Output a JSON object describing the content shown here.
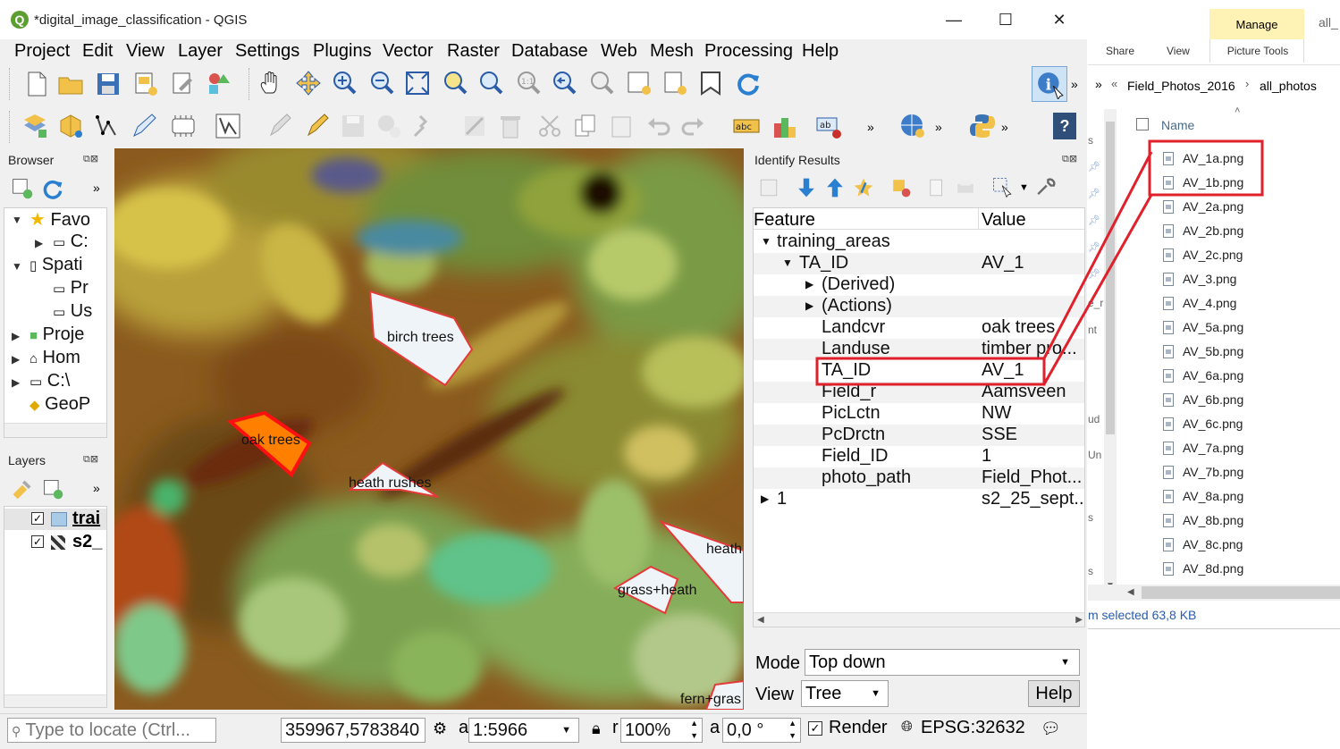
{
  "window": {
    "title": "*digital_image_classification - QGIS"
  },
  "menu": [
    "Project",
    "Edit",
    "View",
    "Layer",
    "Settings",
    "Plugins",
    "Vector",
    "Raster",
    "Database",
    "Web",
    "Mesh",
    "Processing",
    "Help"
  ],
  "browser": {
    "title": "Browser",
    "items": [
      {
        "label": "Favo",
        "icon": "star-icon"
      },
      {
        "label": "C:",
        "icon": "folder-icon"
      },
      {
        "label": "Spati",
        "icon": "book-icon"
      },
      {
        "label": "Pr",
        "icon": "folder-icon"
      },
      {
        "label": "Us",
        "icon": "folder-icon"
      },
      {
        "label": "Proje",
        "icon": "project-icon"
      },
      {
        "label": "Hom",
        "icon": "home-icon"
      },
      {
        "label": "C:\\",
        "icon": "drive-icon"
      },
      {
        "label": "GeoP",
        "icon": "geopackage-icon"
      }
    ]
  },
  "layers": {
    "title": "Layers",
    "items": [
      {
        "label": "trai",
        "checked": true
      },
      {
        "label": "s2_",
        "checked": true
      }
    ]
  },
  "map": {
    "labels": [
      "birch trees",
      "oak trees",
      "heath rushes",
      "heath",
      "grass+heath",
      "fern+gras"
    ]
  },
  "identify": {
    "title": "Identify Results",
    "col_feature": "Feature",
    "col_value": "Value",
    "rows": [
      {
        "feature": "training_areas",
        "value": ""
      },
      {
        "feature": "TA_ID",
        "value": "AV_1"
      },
      {
        "feature": "(Derived)",
        "value": ""
      },
      {
        "feature": "(Actions)",
        "value": ""
      },
      {
        "feature": "Landcvr",
        "value": "oak trees"
      },
      {
        "feature": "Landuse",
        "value": "timber pro..."
      },
      {
        "feature": "TA_ID",
        "value": "AV_1"
      },
      {
        "feature": "Field_r",
        "value": "Aamsveen"
      },
      {
        "feature": "PicLctn",
        "value": "NW"
      },
      {
        "feature": "PcDrctn",
        "value": "SSE"
      },
      {
        "feature": "Field_ID",
        "value": "1"
      },
      {
        "feature": "photo_path",
        "value": "Field_Phot..."
      },
      {
        "feature": "1",
        "value": "s2_25_sept..."
      }
    ],
    "mode_label": "Mode",
    "mode_value": "Top down",
    "view_label": "View",
    "view_value": "Tree",
    "help_label": "Help"
  },
  "status": {
    "locate_placeholder": "Type to locate (Ctrl...",
    "coordinate": "359967,5783840",
    "scale": "1:5966",
    "magnifier": "100%",
    "rotation": "0,0 °",
    "render_label": "Render",
    "crs": "EPSG:32632",
    "coord_prefix": "",
    "scale_prefix": "a",
    "mag_prefix": "r",
    "rot_prefix": "a"
  },
  "explorer": {
    "ribbon_manage": "Manage",
    "ribbon_tab_all": "all_",
    "ribbon_share": "Share",
    "ribbon_view": "View",
    "ribbon_picture_tools": "Picture Tools",
    "path_folder": "Field_Photos_2016",
    "path_sub": "all_photos",
    "column_name": "Name",
    "files": [
      "AV_1a.png",
      "AV_1b.png",
      "AV_2a.png",
      "AV_2b.png",
      "AV_2c.png",
      "AV_3.png",
      "AV_4.png",
      "AV_5a.png",
      "AV_5b.png",
      "AV_6a.png",
      "AV_6b.png",
      "AV_6c.png",
      "AV_7a.png",
      "AV_7b.png",
      "AV_8a.png",
      "AV_8b.png",
      "AV_8c.png",
      "AV_8d.png"
    ],
    "status_text": "m selected  63,8 KB",
    "side_fragments": [
      "s",
      "e_r",
      "nt",
      "ud",
      "Un",
      "s",
      "s"
    ]
  },
  "colors": {
    "highlight_red": "#e0202b",
    "qgis_green": "#5c9e31",
    "selected_layer_fill": "#ff7f00"
  }
}
